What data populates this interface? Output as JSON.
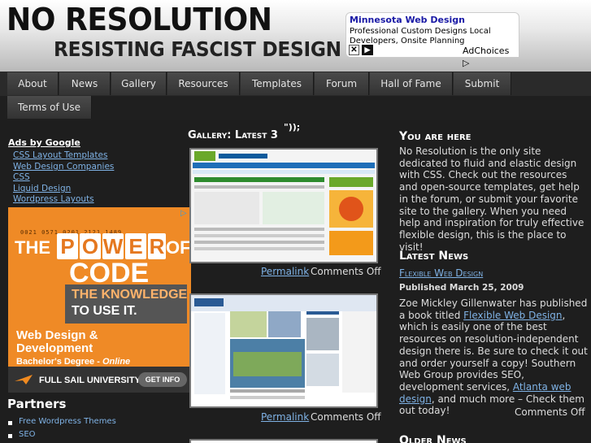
{
  "header": {
    "logo_line1": "NO RESOLUTION",
    "logo_line2": "RESISTING FASCIST DESIGN"
  },
  "top_ad": {
    "title": "Minnesota Web Design",
    "description": "Professional Custom Designs Local Developers, Onsite Planning",
    "close_glyph": "✕",
    "play_glyph": "▶",
    "adchoices": "AdChoices ▷"
  },
  "nav": {
    "items": [
      "About",
      "News",
      "Gallery",
      "Resources",
      "Templates",
      "Forum",
      "Hall of Fame",
      "Submit",
      "Terms of Use"
    ]
  },
  "left": {
    "ads_title": "Ads by Google",
    "ad_links": [
      "CSS Layout Templates",
      "Web Design Companies",
      "CSS",
      "Liquid Design",
      "Wordpress Layouts"
    ],
    "banner": {
      "numbers": "0021 0571 0201 2121 1489",
      "the": "THE",
      "power": [
        "P",
        "O",
        "W",
        "E",
        "R"
      ],
      "of": "OF",
      "code": "CODE",
      "knowledge1": "THE KNOWLEDGE",
      "knowledge2": "TO USE IT.",
      "degree1": "Web Design &",
      "degree2": "Development",
      "degree3": "Bachelor's Degree - ",
      "degree3_italic": "Online",
      "school": "FULL SAIL UNIVERSITY.",
      "get_info": "GET INFO",
      "ad_marker": "▷"
    },
    "partners_title": "Partners",
    "partner_links": [
      "Free Wordpress Themes",
      "SEO"
    ]
  },
  "gallery": {
    "title": "Gallery: Latest 3",
    "stray_text": "\"));",
    "entries": [
      {
        "permalink": "Permalink",
        "comments": "Comments Off"
      },
      {
        "permalink": "Permalink",
        "comments": "Comments Off"
      }
    ]
  },
  "right": {
    "you_are_here_title": "You are here",
    "you_are_here_text": "No Resolution is the only site dedicated to fluid and elastic design with CSS. Check out the resources and open-source templates, get help in the forum, or submit your favorite site to the gallery. When you need help and inspiration for truly effective flexible design, this is the place to visit!",
    "latest_news_title": "Latest News",
    "news_title": "Flexible Web Design",
    "published": "Published March 25, 2009",
    "news_text_1": "Zoe Mickley Gillenwater has published a book titled ",
    "news_link_1": "Flexible Web Design",
    "news_text_2": ", which is easily one of the best resources on resolution-independent design there is. Be sure to check it out and order yourself a copy! Southern Web Group provides SEO, development services, ",
    "news_link_2": "Atlanta web design",
    "news_text_3": ", and much more – Check them out today!",
    "comments": "Comments Off",
    "older_news_title": "Older News"
  },
  "colors": {
    "link": "#7fb2e5",
    "banner_orange": "#ef8a26",
    "background": "#1e1e1e"
  }
}
